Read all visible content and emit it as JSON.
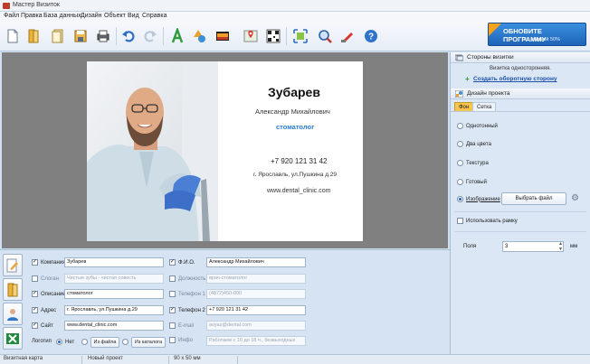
{
  "window": {
    "title": "Мастер Визиток"
  },
  "menu": [
    "Файл",
    "Правка",
    "База данных",
    "Дизайн",
    "Объект",
    "Вид",
    "Справка"
  ],
  "promo": {
    "title": "ОБНОВИТЕ ПРОГРАММУ",
    "subtitle": "со скидкой 50%"
  },
  "card": {
    "name": "Зубарев",
    "full_name": "Александр Михайлович",
    "position": "стоматолог",
    "phone": "+7 920 121 31 42",
    "address": "г. Ярославль, ул.Пушкина д.29",
    "website": "www.dental_clinic.com"
  },
  "fields_left": [
    {
      "label": "Компания",
      "value": "Зубарев",
      "checked": true
    },
    {
      "label": "Слоган",
      "value": "Чистые зубы - чистая совесть",
      "checked": false
    },
    {
      "label": "Описание",
      "value": "стоматолог",
      "checked": true
    },
    {
      "label": "Адрес",
      "value": "г. Ярославль, ул.Пушкина д.29",
      "checked": true
    },
    {
      "label": "Сайт",
      "value": "www.dental_clinic.com",
      "checked": true
    }
  ],
  "fields_right": [
    {
      "label": "Ф.И.О.",
      "value": "Александр Михайлович",
      "checked": true
    },
    {
      "label": "Должность",
      "value": "врач-стоматолог",
      "checked": false
    },
    {
      "label": "Телефон 1",
      "value": "(4872)450-000",
      "checked": false
    },
    {
      "label": "Телефон 2",
      "value": "+7 920 121 31 42",
      "checked": true
    },
    {
      "label": "E-mail",
      "value": "avyaz@dental.com",
      "checked": false
    },
    {
      "label": "Инфо",
      "value": "Работаем с 10 до 18 ч., безвыходных",
      "checked": false
    }
  ],
  "logo": {
    "label": "Логотип",
    "options": [
      "Нет",
      "Из файла",
      "Из каталога"
    ],
    "selected": "Нет"
  },
  "right_panel": {
    "sides_header": "Стороны визитки",
    "sides_info": "Визитка односторонняя.",
    "create_back_link": "Создать оборотную сторону",
    "design_header": "Дизайн проекта",
    "tabs": [
      "Фон",
      "Сетка"
    ],
    "active_tab": "Фон",
    "background_options": [
      "Однотонный",
      "Два цвета",
      "Текстура",
      "Готовый",
      "Изображение"
    ],
    "selected_option": "Изображение",
    "choose_file_button": "Выбрать файл",
    "use_frame_label": "Использовать рамку",
    "use_frame": false,
    "margins_label": "Поля",
    "margins_value": "3",
    "margins_unit": "мм"
  },
  "status": {
    "type": "Визитная карта",
    "project": "Новый проект",
    "size": "90 x 50 мм"
  }
}
